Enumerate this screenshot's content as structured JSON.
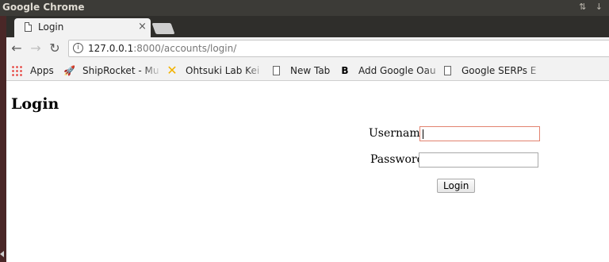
{
  "os": {
    "title": "Google Chrome",
    "icons": "⇅ ↓"
  },
  "tab": {
    "title": "Login",
    "close": "×"
  },
  "toolbar": {
    "back": "←",
    "forward": "→",
    "reload": "↻",
    "info": "i",
    "url_host": "127.0.0.1",
    "url_rest": ":8000/accounts/login/"
  },
  "bookmarks": [
    {
      "label": "Apps",
      "icon": "apps-grid"
    },
    {
      "label": "ShipRocket - Mu",
      "icon": "rocket"
    },
    {
      "label": "Ohtsuki Lab Kei",
      "icon": "x-mark"
    },
    {
      "label": "New Tab",
      "icon": "page"
    },
    {
      "label": "Add Google Oau",
      "icon": "b-letter"
    },
    {
      "label": "Google SERPs E",
      "icon": "page"
    }
  ],
  "page": {
    "title": "Login",
    "username_label": "Username:",
    "password_label": "Password:",
    "username_value": "",
    "password_value": "",
    "login_button": "Login"
  }
}
